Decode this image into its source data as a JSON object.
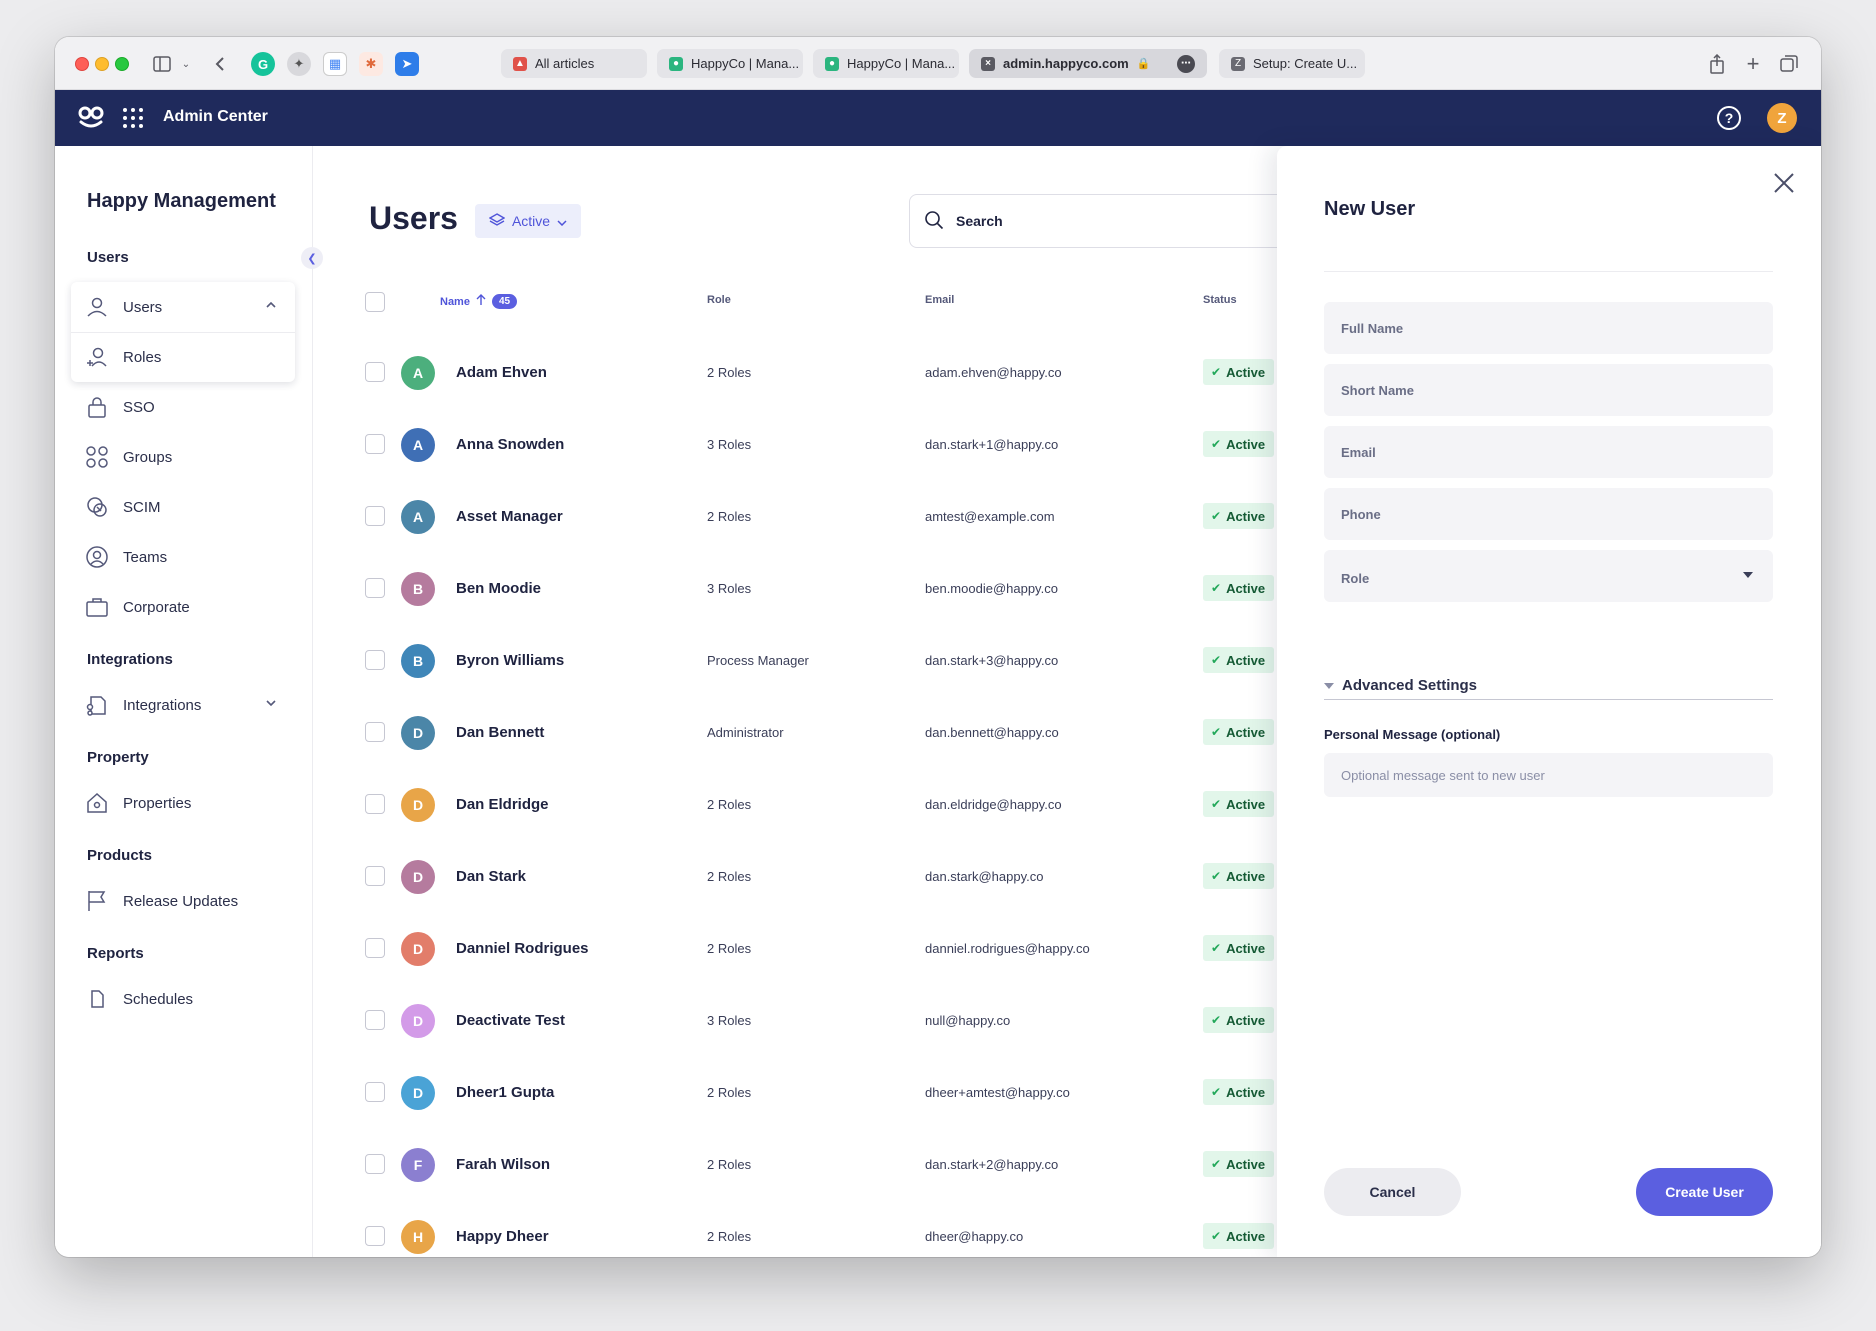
{
  "browser": {
    "tabs": [
      {
        "label": "All articles",
        "active": false
      },
      {
        "label": "HappyCo | Mana...",
        "active": false
      },
      {
        "label": "HappyCo | Mana...",
        "active": false
      },
      {
        "label": "admin.happyco.com",
        "active": true
      },
      {
        "label": "Setup: Create U...",
        "active": false
      }
    ]
  },
  "appbar": {
    "title": "Admin Center",
    "user_initial": "Z",
    "help_glyph": "?"
  },
  "sidebar": {
    "org_name": "Happy Management",
    "sections": {
      "users": "Users",
      "integrations": "Integrations",
      "property": "Property",
      "products": "Products",
      "reports": "Reports"
    },
    "items": {
      "users": "Users",
      "roles": "Roles",
      "sso": "SSO",
      "groups": "Groups",
      "scim": "SCIM",
      "teams": "Teams",
      "corporate": "Corporate",
      "integrations": "Integrations",
      "properties": "Properties",
      "release_updates": "Release Updates",
      "schedules": "Schedules"
    }
  },
  "main": {
    "title": "Users",
    "status_filter": "Active",
    "search_placeholder": "Search",
    "columns": {
      "name": "Name",
      "count": "45",
      "role": "Role",
      "email": "Email",
      "status": "Status"
    },
    "rows": [
      {
        "initial": "A",
        "color": "#4caf7d",
        "name": "Adam Ehven",
        "role": "2 Roles",
        "email": "adam.ehven@happy.co",
        "status": "Active"
      },
      {
        "initial": "A",
        "color": "#3f6fb5",
        "name": "Anna Snowden",
        "role": "3 Roles",
        "email": "dan.stark+1@happy.co",
        "status": "Active"
      },
      {
        "initial": "A",
        "color": "#4b86a8",
        "name": "Asset Manager",
        "role": "2 Roles",
        "email": "amtest@example.com",
        "status": "Active"
      },
      {
        "initial": "B",
        "color": "#b57b9e",
        "name": "Ben Moodie",
        "role": "3 Roles",
        "email": "ben.moodie@happy.co",
        "status": "Active"
      },
      {
        "initial": "B",
        "color": "#3f86b8",
        "name": "Byron Williams",
        "role": "Process Manager",
        "email": "dan.stark+3@happy.co",
        "status": "Active"
      },
      {
        "initial": "D",
        "color": "#4b86a8",
        "name": "Dan Bennett",
        "role": "Administrator",
        "email": "dan.bennett@happy.co",
        "status": "Active"
      },
      {
        "initial": "D",
        "color": "#e8a548",
        "name": "Dan Eldridge",
        "role": "2 Roles",
        "email": "dan.eldridge@happy.co",
        "status": "Active"
      },
      {
        "initial": "D",
        "color": "#b57b9e",
        "name": "Dan Stark",
        "role": "2 Roles",
        "email": "dan.stark@happy.co",
        "status": "Active"
      },
      {
        "initial": "D",
        "color": "#e27d6a",
        "name": "Danniel Rodrigues",
        "role": "2 Roles",
        "email": "danniel.rodrigues@happy.co",
        "status": "Active"
      },
      {
        "initial": "D",
        "color": "#d39be8",
        "name": "Deactivate Test",
        "role": "3 Roles",
        "email": "null@happy.co",
        "status": "Active"
      },
      {
        "initial": "D",
        "color": "#4aa3d6",
        "name": "Dheer1 Gupta",
        "role": "2 Roles",
        "email": "dheer+amtest@happy.co",
        "status": "Active"
      },
      {
        "initial": "F",
        "color": "#8b7fd0",
        "name": "Farah Wilson",
        "role": "2 Roles",
        "email": "dan.stark+2@happy.co",
        "status": "Active"
      },
      {
        "initial": "H",
        "color": "#e8a548",
        "name": "Happy Dheer",
        "role": "2 Roles",
        "email": "dheer@happy.co",
        "status": "Active"
      }
    ]
  },
  "drawer": {
    "title": "New User",
    "full_name_placeholder": "Full Name",
    "short_name_placeholder": "Short Name",
    "email_placeholder": "Email",
    "phone_placeholder": "Phone",
    "role_label": "Role",
    "advanced_label": "Advanced Settings",
    "personal_message_label": "Personal Message (optional)",
    "personal_message_placeholder": "Optional message sent to new user",
    "cancel_label": "Cancel",
    "create_label": "Create User"
  },
  "colors": {
    "header_bg": "#1f2a5c",
    "accent": "#5b5fe0",
    "status_bg": "#e2f6ea"
  }
}
